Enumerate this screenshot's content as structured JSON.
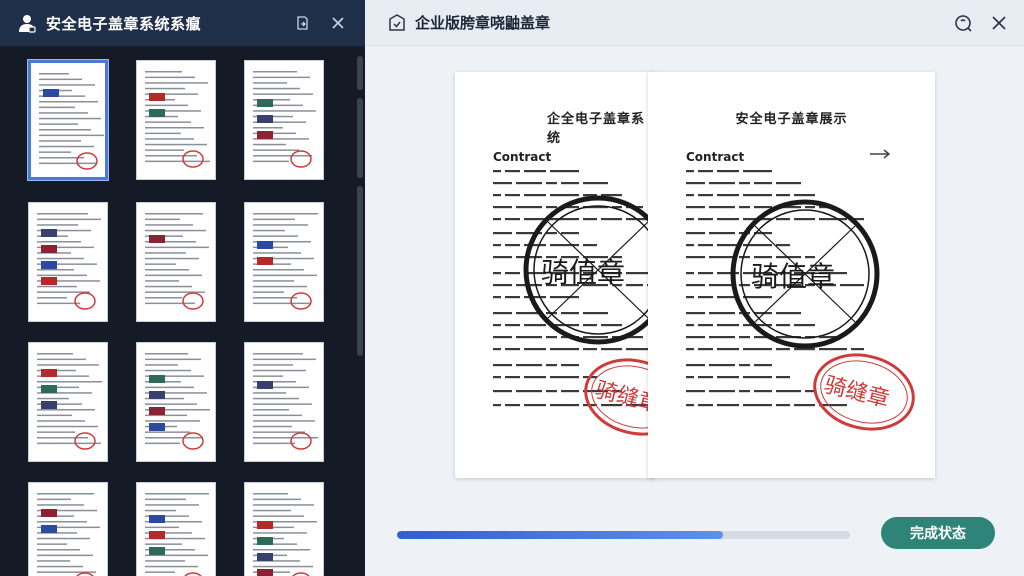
{
  "left_panel": {
    "title": "安全电子盖章系统系癙",
    "icons": {
      "app": "user-icon",
      "export": "export-icon",
      "close": "close-icon"
    },
    "thumbnails_count": 12,
    "selected_index": 0
  },
  "right_panel": {
    "title": "企业版胯章哓鼬盖章",
    "icons": {
      "doc": "shield-doc-icon",
      "search": "search-icon",
      "close": "close-icon"
    },
    "preview": {
      "left_page": {
        "title": "企全电子盖章系统",
        "heading": "Contract"
      },
      "right_page": {
        "title": "安全电子盖章展示",
        "heading": "Contract"
      },
      "black_stamp_text": "骑值章",
      "black_stamp_text_right": "骑值章",
      "red_stamp_text": "骑缝章"
    },
    "progress": 0.72,
    "done_button": "完成状态"
  },
  "colors": {
    "left_bg": "#151b26",
    "left_header": "#1f2f4a",
    "accent_blue": "#3b6fd8",
    "button_teal": "#2f8479",
    "stamp_red": "#d03a3a"
  }
}
